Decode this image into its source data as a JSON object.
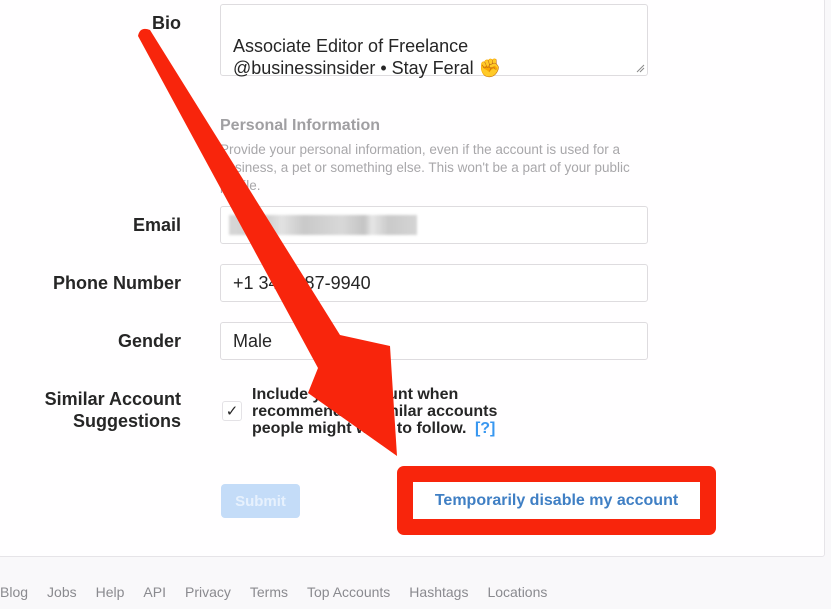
{
  "form": {
    "bio": {
      "label": "Bio",
      "value": "Associate Editor of Freelance\n@businessinsider • Stay Feral ✊"
    },
    "personal_info": {
      "title": "Personal Information",
      "description": "Provide your personal information, even if the account is used for a business, a pet or something else. This won't be a part of your public profile."
    },
    "email": {
      "label": "Email",
      "value": "(blurred)"
    },
    "phone": {
      "label": "Phone Number",
      "value": "+1 347-287-9940"
    },
    "gender": {
      "label": "Gender",
      "value": "Male"
    },
    "similar_accounts": {
      "label_line1": "Similar Account",
      "label_line2": "Suggestions",
      "checked": true,
      "check_glyph": "✓",
      "text": "Include your account when recommending similar accounts people might want to follow.",
      "help_link": "[?]"
    },
    "submit_label": "Submit",
    "disable_label": "Temporarily disable my account"
  },
  "footer": {
    "links": [
      "Blog",
      "Jobs",
      "Help",
      "API",
      "Privacy",
      "Terms",
      "Top Accounts",
      "Hashtags",
      "Locations"
    ]
  },
  "annotation": {
    "arrow_color": "#f8250c",
    "highlight_color": "#f8250c"
  },
  "colors": {
    "link_blue": "#3897f0",
    "disable_link": "#3f7fc4",
    "submit_disabled_bg": "#c4dcf8"
  }
}
